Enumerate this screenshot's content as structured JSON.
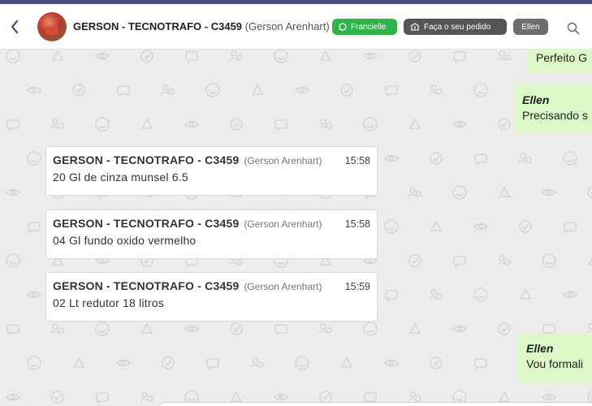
{
  "header": {
    "contact_name": "GERSON - TECNOTRAFO - C3459",
    "contact_sub": "(Gerson Arenhart)",
    "tag_attendant": "Francielle",
    "tag_order": "Faça o seu pedido",
    "tag_user": "Ellen"
  },
  "messages_in": [
    {
      "sender": "GERSON - TECNOTRAFO - C3459",
      "sender_sub": "(Gerson Arenhart)",
      "time": "15:58",
      "text": "20 Gl de cinza munsel 6.5"
    },
    {
      "sender": "GERSON - TECNOTRAFO - C3459",
      "sender_sub": "(Gerson Arenhart)",
      "time": "15:58",
      "text": "04 Gl fundo oxido vermelho"
    },
    {
      "sender": "GERSON - TECNOTRAFO - C3459",
      "sender_sub": "(Gerson Arenhart)",
      "time": "15:59",
      "text": "02 Lt redutor 18 litros"
    }
  ],
  "messages_out": [
    {
      "text": "Perfeito G"
    },
    {
      "name": "Ellen",
      "text": "Precisando s"
    },
    {
      "name": "Ellen",
      "text": "Vou formali"
    }
  ],
  "icons": {
    "back": "chevron-left-icon",
    "whatsapp": "whatsapp-icon",
    "order": "shop-icon",
    "search": "search-icon"
  },
  "colors": {
    "tag_green": "#2fb34a",
    "tag_dark": "#555555",
    "tag_grey": "#6e6e6e",
    "outgoing_bubble": "#dcf8c6",
    "top_strip": "#45507a"
  }
}
